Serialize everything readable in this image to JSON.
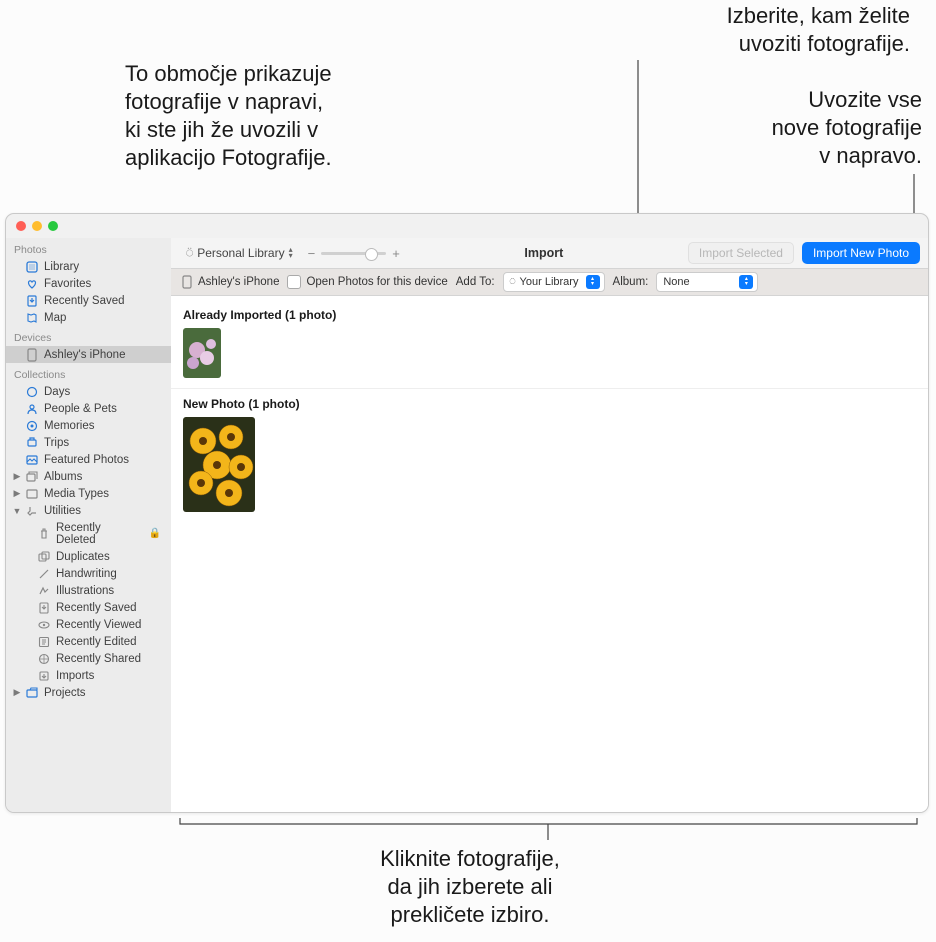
{
  "annotations": {
    "top_left": "To območje prikazuje\nfotografije v napravi,\nki ste jih že uvozili v\naplikacijo Fotografije.",
    "top_right1": "Izberite, kam želite\nuvoziti fotografije.",
    "top_right2": "Uvozite vse\nnove fotografije\nv napravo.",
    "bottom": "Kliknite fotografije,\nda jih izberete ali\nprekličete izbiro."
  },
  "topbar": {
    "library_label": "Personal Library",
    "title": "Import",
    "import_selected": "Import Selected",
    "import_new": "Import New Photo"
  },
  "subbar": {
    "device": "Ashley's iPhone",
    "open_for_device": "Open Photos for this device",
    "add_to_label": "Add To:",
    "add_to_value": "Your Library",
    "album_label": "Album:",
    "album_value": "None"
  },
  "content": {
    "already_imported_header": "Already Imported (1 photo)",
    "new_photo_header": "New Photo (1 photo)"
  },
  "sidebar": {
    "sections": {
      "photos": "Photos",
      "devices": "Devices",
      "collections": "Collections"
    },
    "photos": {
      "library": "Library",
      "favorites": "Favorites",
      "recently_saved": "Recently Saved",
      "map": "Map"
    },
    "devices": {
      "ashley": "Ashley's iPhone"
    },
    "collections": {
      "days": "Days",
      "people_pets": "People & Pets",
      "memories": "Memories",
      "trips": "Trips",
      "featured": "Featured Photos",
      "albums": "Albums",
      "media_types": "Media Types",
      "utilities": "Utilities"
    },
    "utilities": {
      "recently_deleted": "Recently Deleted",
      "duplicates": "Duplicates",
      "handwriting": "Handwriting",
      "illustrations": "Illustrations",
      "recently_saved": "Recently Saved",
      "recently_viewed": "Recently Viewed",
      "recently_edited": "Recently Edited",
      "recently_shared": "Recently Shared",
      "imports": "Imports"
    },
    "projects": "Projects"
  }
}
